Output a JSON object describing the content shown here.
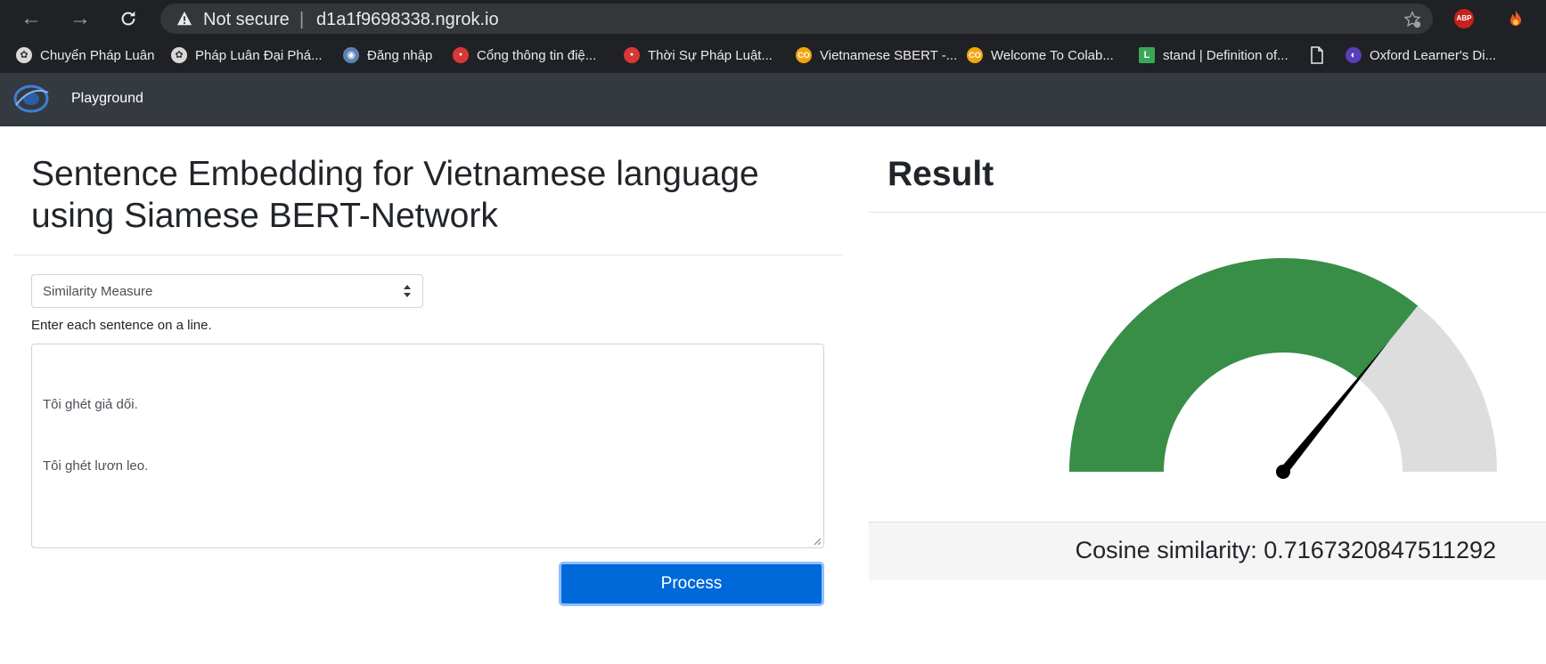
{
  "browser": {
    "security_status": "Not secure",
    "url": "d1a1f9698338.ngrok.io",
    "extensions": [
      "ABP",
      "fire-icon"
    ],
    "bookmarks": [
      {
        "label": "Chuyển Pháp Luân",
        "icon": "lotus-icon"
      },
      {
        "label": "Pháp Luân Đại Phá...",
        "icon": "lotus-icon"
      },
      {
        "label": "Đăng nhập",
        "icon": "globe-icon"
      },
      {
        "label": "Cổng thông tin điệ...",
        "icon": "red-badge-icon"
      },
      {
        "label": "Thời Sự Pháp Luật...",
        "icon": "red-badge-icon"
      },
      {
        "label": "Vietnamese SBERT -...",
        "icon": "colab-icon"
      },
      {
        "label": "Welcome To Colab...",
        "icon": "colab-icon"
      },
      {
        "label": "stand | Definition of...",
        "icon": "l-icon"
      },
      {
        "label": "",
        "icon": "page-icon"
      },
      {
        "label": "Oxford Learner's Di...",
        "icon": "oxford-icon"
      }
    ]
  },
  "navbar": {
    "brand": "Playground"
  },
  "main": {
    "title": "Sentence Embedding for Vietnamese language using Siamese BERT-Network",
    "select_value": "Similarity Measure",
    "hint": "Enter each sentence on a line.",
    "sentences": [
      "Tôi ghét giả dối.",
      "Tôi ghét lươn leo."
    ],
    "process_label": "Process"
  },
  "result": {
    "title": "Result",
    "cosine_text": "Cosine similarity: 0.7167320847511292",
    "gauge_value": 0.7167320847511292,
    "colors": {
      "filled": "#388e47",
      "empty": "#dddddd",
      "needle": "#000000"
    }
  }
}
